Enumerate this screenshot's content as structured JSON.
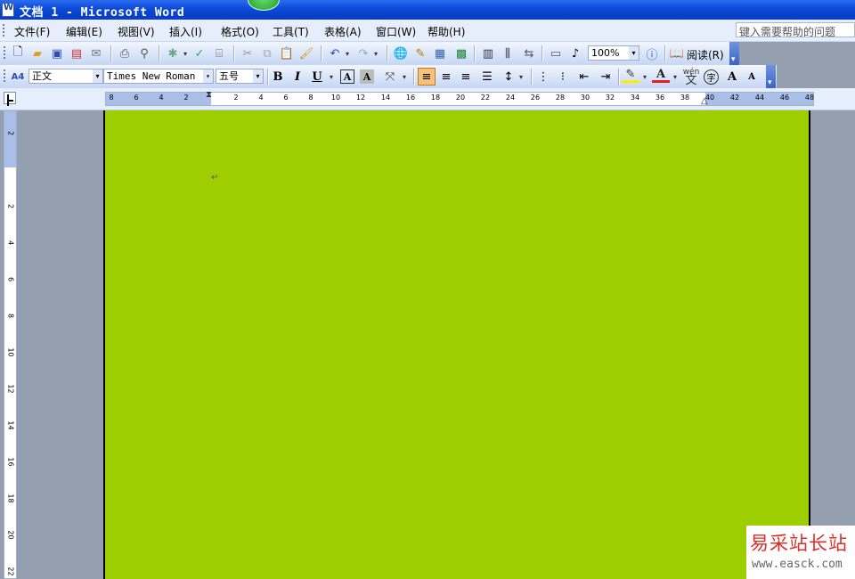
{
  "window": {
    "title": "文档 1 - Microsoft Word"
  },
  "menubar": {
    "items": [
      "文件(F)",
      "编辑(E)",
      "视图(V)",
      "插入(I)",
      "格式(O)",
      "工具(T)",
      "表格(A)",
      "窗口(W)",
      "帮助(H)"
    ],
    "help_placeholder": "键入需要帮助的问题"
  },
  "toolbar_standard": {
    "zoom": "100%",
    "read_label": "阅读(R)",
    "icons": [
      "new-document-icon",
      "open-icon",
      "save-icon",
      "permission-icon",
      "email-icon",
      "print-icon",
      "print-preview-icon",
      "research-icon",
      "spelling-icon",
      "cut-icon",
      "copy-icon",
      "paste-icon",
      "format-painter-icon",
      "undo-icon",
      "redo-icon",
      "hyperlink-icon",
      "tables-borders-icon",
      "insert-table-icon",
      "insert-excel-icon",
      "columns-icon",
      "drawing-icon",
      "document-map-icon",
      "show-hide-icon",
      "help-icon",
      "read-icon"
    ]
  },
  "toolbar_format": {
    "style": "正文",
    "style_icon_label": "A4",
    "font": "Times New Roman",
    "size": "五号",
    "bold": "B",
    "italic": "I",
    "underline": "U",
    "char_border": "A",
    "char_shading": "A",
    "font_color": "A",
    "phonetic": "wén",
    "grow_font": "A",
    "shrink_font": "A",
    "enclose_char": "字"
  },
  "ruler": {
    "horizontal_labels": [
      "8",
      "6",
      "4",
      "2",
      "",
      "2",
      "4",
      "6",
      "8",
      "10",
      "12",
      "14",
      "16",
      "18",
      "20",
      "22",
      "24",
      "26",
      "28",
      "30",
      "32",
      "34",
      "36",
      "38",
      "40",
      "42",
      "44",
      "46",
      "48"
    ],
    "vertical_labels": [
      "2",
      "",
      "2",
      "4",
      "6",
      "8",
      "10",
      "12",
      "14",
      "16",
      "18",
      "20",
      "22"
    ]
  },
  "document": {
    "page_color": "#9dcf00",
    "paragraph_mark": "↵"
  },
  "watermark": {
    "title": "易采站长站",
    "url": "www.easck.com"
  }
}
